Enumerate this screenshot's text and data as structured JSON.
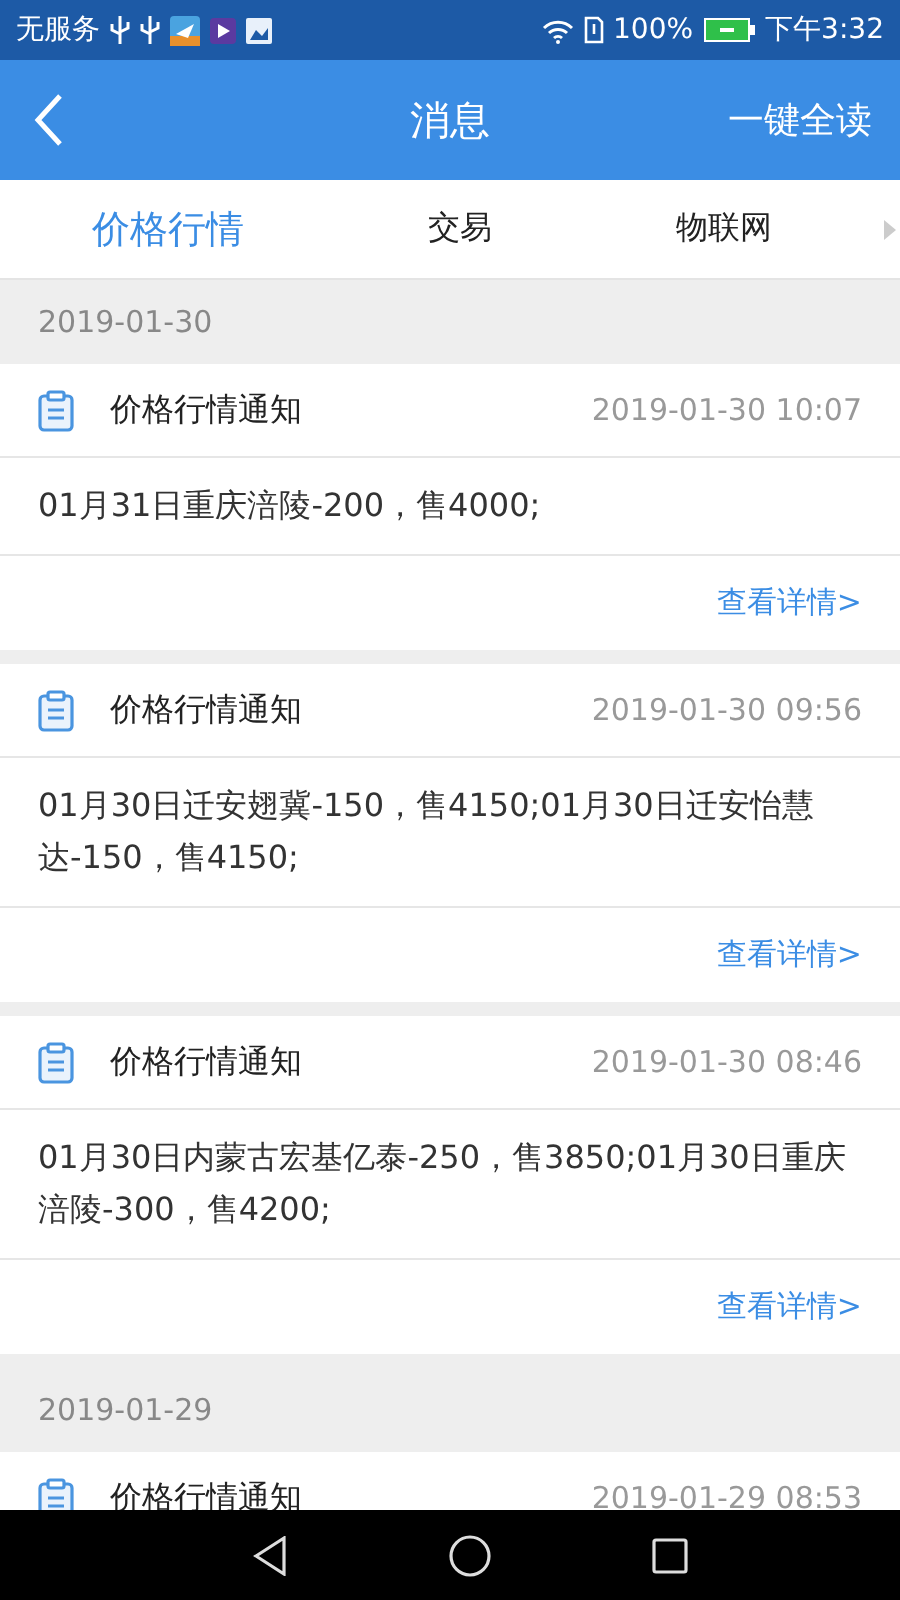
{
  "status_bar": {
    "carrier": "无服务",
    "battery": "100%",
    "time": "下午3:32"
  },
  "header": {
    "title": "消息",
    "action": "一键全读"
  },
  "tabs": [
    {
      "label": "价格行情",
      "selected": true
    },
    {
      "label": "交易",
      "selected": false
    },
    {
      "label": "物联网",
      "selected": false
    }
  ],
  "groups": [
    {
      "date": "2019-01-30",
      "messages": [
        {
          "title": "价格行情通知",
          "time": "2019-01-30 10:07",
          "body": "01月31日重庆涪陵-200，售4000;",
          "link": "查看详情>"
        },
        {
          "title": "价格行情通知",
          "time": "2019-01-30 09:56",
          "body": "01月30日迁安翅冀-150，售4150;01月30日迁安怡慧达-150，售4150;",
          "link": "查看详情>"
        },
        {
          "title": "价格行情通知",
          "time": "2019-01-30 08:46",
          "body": "01月30日内蒙古宏基亿泰-250，售3850;01月30日重庆涪陵-300，售4200;",
          "link": "查看详情>"
        }
      ]
    },
    {
      "date": "2019-01-29",
      "messages": [
        {
          "title": "价格行情通知",
          "time": "2019-01-29 08:53"
        }
      ]
    }
  ]
}
